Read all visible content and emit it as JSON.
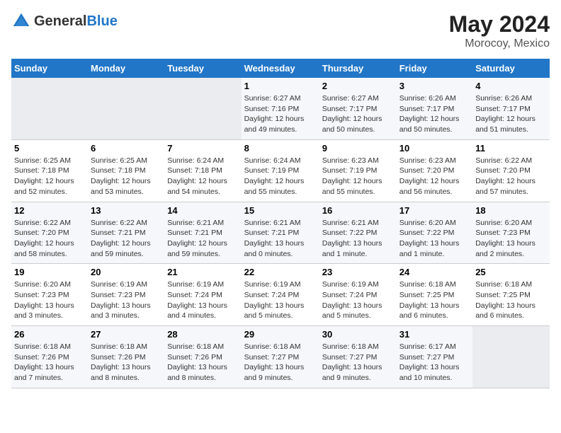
{
  "logo": {
    "text_general": "General",
    "text_blue": "Blue"
  },
  "header": {
    "main_title": "May 2024",
    "subtitle": "Morocoy, Mexico"
  },
  "days_of_week": [
    "Sunday",
    "Monday",
    "Tuesday",
    "Wednesday",
    "Thursday",
    "Friday",
    "Saturday"
  ],
  "weeks": [
    {
      "days": [
        {
          "number": "",
          "info": "",
          "empty": true
        },
        {
          "number": "",
          "info": "",
          "empty": true
        },
        {
          "number": "",
          "info": "",
          "empty": true
        },
        {
          "number": "1",
          "info": "Sunrise: 6:27 AM\nSunset: 7:16 PM\nDaylight: 12 hours\nand 49 minutes.",
          "empty": false
        },
        {
          "number": "2",
          "info": "Sunrise: 6:27 AM\nSunset: 7:17 PM\nDaylight: 12 hours\nand 50 minutes.",
          "empty": false
        },
        {
          "number": "3",
          "info": "Sunrise: 6:26 AM\nSunset: 7:17 PM\nDaylight: 12 hours\nand 50 minutes.",
          "empty": false
        },
        {
          "number": "4",
          "info": "Sunrise: 6:26 AM\nSunset: 7:17 PM\nDaylight: 12 hours\nand 51 minutes.",
          "empty": false
        }
      ]
    },
    {
      "days": [
        {
          "number": "5",
          "info": "Sunrise: 6:25 AM\nSunset: 7:18 PM\nDaylight: 12 hours\nand 52 minutes.",
          "empty": false
        },
        {
          "number": "6",
          "info": "Sunrise: 6:25 AM\nSunset: 7:18 PM\nDaylight: 12 hours\nand 53 minutes.",
          "empty": false
        },
        {
          "number": "7",
          "info": "Sunrise: 6:24 AM\nSunset: 7:18 PM\nDaylight: 12 hours\nand 54 minutes.",
          "empty": false
        },
        {
          "number": "8",
          "info": "Sunrise: 6:24 AM\nSunset: 7:19 PM\nDaylight: 12 hours\nand 55 minutes.",
          "empty": false
        },
        {
          "number": "9",
          "info": "Sunrise: 6:23 AM\nSunset: 7:19 PM\nDaylight: 12 hours\nand 55 minutes.",
          "empty": false
        },
        {
          "number": "10",
          "info": "Sunrise: 6:23 AM\nSunset: 7:20 PM\nDaylight: 12 hours\nand 56 minutes.",
          "empty": false
        },
        {
          "number": "11",
          "info": "Sunrise: 6:22 AM\nSunset: 7:20 PM\nDaylight: 12 hours\nand 57 minutes.",
          "empty": false
        }
      ]
    },
    {
      "days": [
        {
          "number": "12",
          "info": "Sunrise: 6:22 AM\nSunset: 7:20 PM\nDaylight: 12 hours\nand 58 minutes.",
          "empty": false
        },
        {
          "number": "13",
          "info": "Sunrise: 6:22 AM\nSunset: 7:21 PM\nDaylight: 12 hours\nand 59 minutes.",
          "empty": false
        },
        {
          "number": "14",
          "info": "Sunrise: 6:21 AM\nSunset: 7:21 PM\nDaylight: 12 hours\nand 59 minutes.",
          "empty": false
        },
        {
          "number": "15",
          "info": "Sunrise: 6:21 AM\nSunset: 7:21 PM\nDaylight: 13 hours\nand 0 minutes.",
          "empty": false
        },
        {
          "number": "16",
          "info": "Sunrise: 6:21 AM\nSunset: 7:22 PM\nDaylight: 13 hours\nand 1 minute.",
          "empty": false
        },
        {
          "number": "17",
          "info": "Sunrise: 6:20 AM\nSunset: 7:22 PM\nDaylight: 13 hours\nand 1 minute.",
          "empty": false
        },
        {
          "number": "18",
          "info": "Sunrise: 6:20 AM\nSunset: 7:23 PM\nDaylight: 13 hours\nand 2 minutes.",
          "empty": false
        }
      ]
    },
    {
      "days": [
        {
          "number": "19",
          "info": "Sunrise: 6:20 AM\nSunset: 7:23 PM\nDaylight: 13 hours\nand 3 minutes.",
          "empty": false
        },
        {
          "number": "20",
          "info": "Sunrise: 6:19 AM\nSunset: 7:23 PM\nDaylight: 13 hours\nand 3 minutes.",
          "empty": false
        },
        {
          "number": "21",
          "info": "Sunrise: 6:19 AM\nSunset: 7:24 PM\nDaylight: 13 hours\nand 4 minutes.",
          "empty": false
        },
        {
          "number": "22",
          "info": "Sunrise: 6:19 AM\nSunset: 7:24 PM\nDaylight: 13 hours\nand 5 minutes.",
          "empty": false
        },
        {
          "number": "23",
          "info": "Sunrise: 6:19 AM\nSunset: 7:24 PM\nDaylight: 13 hours\nand 5 minutes.",
          "empty": false
        },
        {
          "number": "24",
          "info": "Sunrise: 6:18 AM\nSunset: 7:25 PM\nDaylight: 13 hours\nand 6 minutes.",
          "empty": false
        },
        {
          "number": "25",
          "info": "Sunrise: 6:18 AM\nSunset: 7:25 PM\nDaylight: 13 hours\nand 6 minutes.",
          "empty": false
        }
      ]
    },
    {
      "days": [
        {
          "number": "26",
          "info": "Sunrise: 6:18 AM\nSunset: 7:26 PM\nDaylight: 13 hours\nand 7 minutes.",
          "empty": false
        },
        {
          "number": "27",
          "info": "Sunrise: 6:18 AM\nSunset: 7:26 PM\nDaylight: 13 hours\nand 8 minutes.",
          "empty": false
        },
        {
          "number": "28",
          "info": "Sunrise: 6:18 AM\nSunset: 7:26 PM\nDaylight: 13 hours\nand 8 minutes.",
          "empty": false
        },
        {
          "number": "29",
          "info": "Sunrise: 6:18 AM\nSunset: 7:27 PM\nDaylight: 13 hours\nand 9 minutes.",
          "empty": false
        },
        {
          "number": "30",
          "info": "Sunrise: 6:18 AM\nSunset: 7:27 PM\nDaylight: 13 hours\nand 9 minutes.",
          "empty": false
        },
        {
          "number": "31",
          "info": "Sunrise: 6:17 AM\nSunset: 7:27 PM\nDaylight: 13 hours\nand 10 minutes.",
          "empty": false
        },
        {
          "number": "",
          "info": "",
          "empty": true
        }
      ]
    }
  ]
}
